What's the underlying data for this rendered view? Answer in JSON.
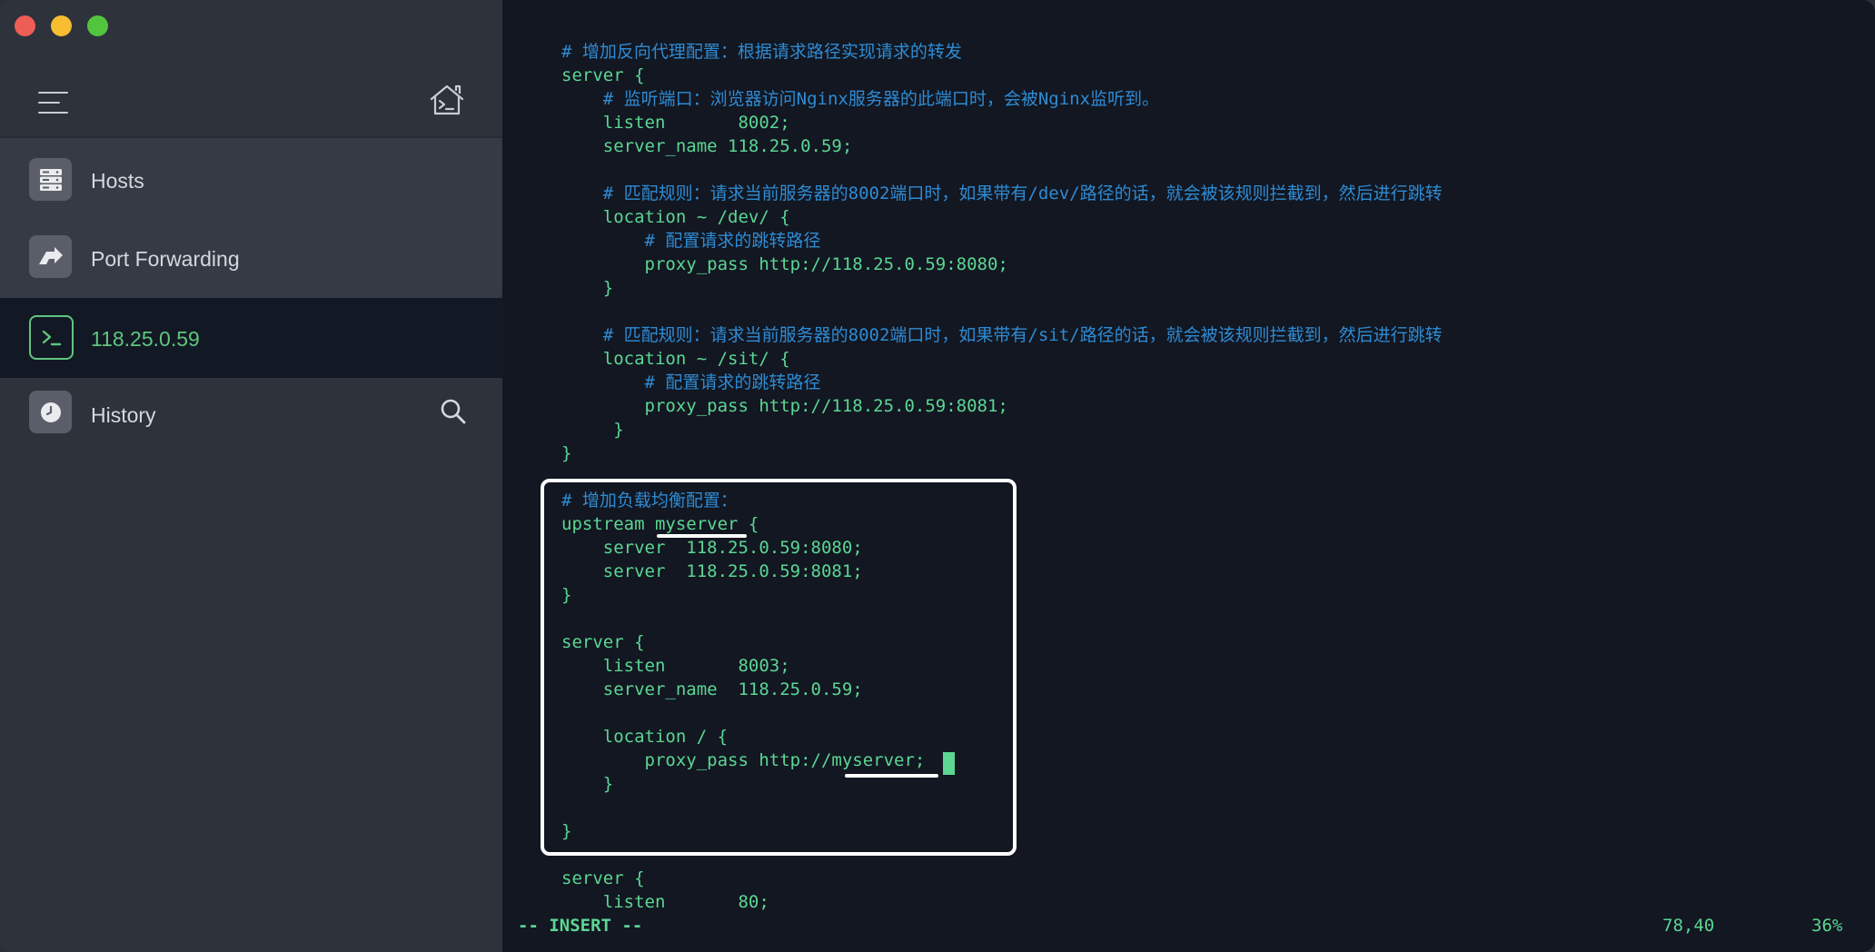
{
  "sidebar": {
    "items": [
      {
        "label": "Hosts",
        "icon": "server-rack-icon"
      },
      {
        "label": "Port Forwarding",
        "icon": "forward-arrow-icon"
      },
      {
        "label": "118.25.0.59",
        "icon": "terminal-icon",
        "active": true
      },
      {
        "label": "History",
        "icon": "clock-icon"
      }
    ]
  },
  "terminal": {
    "lines": [
      {
        "text": "# 增加反向代理配置：根据请求路径实现请求的转发",
        "comment": true
      },
      {
        "text": "server {",
        "comment": false
      },
      {
        "text": "    # 监听端口：浏览器访问Nginx服务器的此端口时，会被Nginx监听到。",
        "comment": true
      },
      {
        "text": "    listen       8002;",
        "comment": false
      },
      {
        "text": "    server_name 118.25.0.59;",
        "comment": false
      },
      {
        "text": "",
        "comment": false
      },
      {
        "text": "    # 匹配规则：请求当前服务器的8002端口时，如果带有/dev/路径的话，就会被该规则拦截到，然后进行跳转",
        "comment": true
      },
      {
        "text": "    location ~ /dev/ {",
        "comment": false
      },
      {
        "text": "        # 配置请求的跳转路径",
        "comment": true
      },
      {
        "text": "        proxy_pass http://118.25.0.59:8080;",
        "comment": false
      },
      {
        "text": "    }",
        "comment": false
      },
      {
        "text": "",
        "comment": false
      },
      {
        "text": "    # 匹配规则：请求当前服务器的8002端口时，如果带有/sit/路径的话，就会被该规则拦截到，然后进行跳转",
        "comment": true
      },
      {
        "text": "    location ~ /sit/ {",
        "comment": false
      },
      {
        "text": "        # 配置请求的跳转路径",
        "comment": true
      },
      {
        "text": "        proxy_pass http://118.25.0.59:8081;",
        "comment": false
      },
      {
        "text": "     }",
        "comment": false
      },
      {
        "text": "}",
        "comment": false
      },
      {
        "text": "",
        "comment": false
      },
      {
        "text": "# 增加负载均衡配置：",
        "comment": true
      },
      {
        "text": "upstream myserver {",
        "comment": false
      },
      {
        "text": "    server  118.25.0.59:8080;",
        "comment": false
      },
      {
        "text": "    server  118.25.0.59:8081;",
        "comment": false
      },
      {
        "text": "}",
        "comment": false
      },
      {
        "text": "",
        "comment": false
      },
      {
        "text": "server {",
        "comment": false
      },
      {
        "text": "    listen       8003;",
        "comment": false
      },
      {
        "text": "    server_name  118.25.0.59;",
        "comment": false
      },
      {
        "text": "",
        "comment": false
      },
      {
        "text": "    location / {",
        "comment": false
      },
      {
        "text": "        proxy_pass http://myserver;",
        "comment": false
      },
      {
        "text": "    }",
        "comment": false
      },
      {
        "text": "",
        "comment": false
      },
      {
        "text": "}",
        "comment": false
      },
      {
        "text": "",
        "comment": false
      },
      {
        "text": "server {",
        "comment": false
      },
      {
        "text": "    listen       80;",
        "comment": false
      }
    ],
    "status": {
      "mode": "-- INSERT --",
      "position": "78,40",
      "percent": "36%"
    }
  },
  "colors": {
    "code": "#5cd692",
    "comment": "#2f8bd3",
    "accent": "#5fc57f",
    "sidebar": "#2e323b"
  }
}
